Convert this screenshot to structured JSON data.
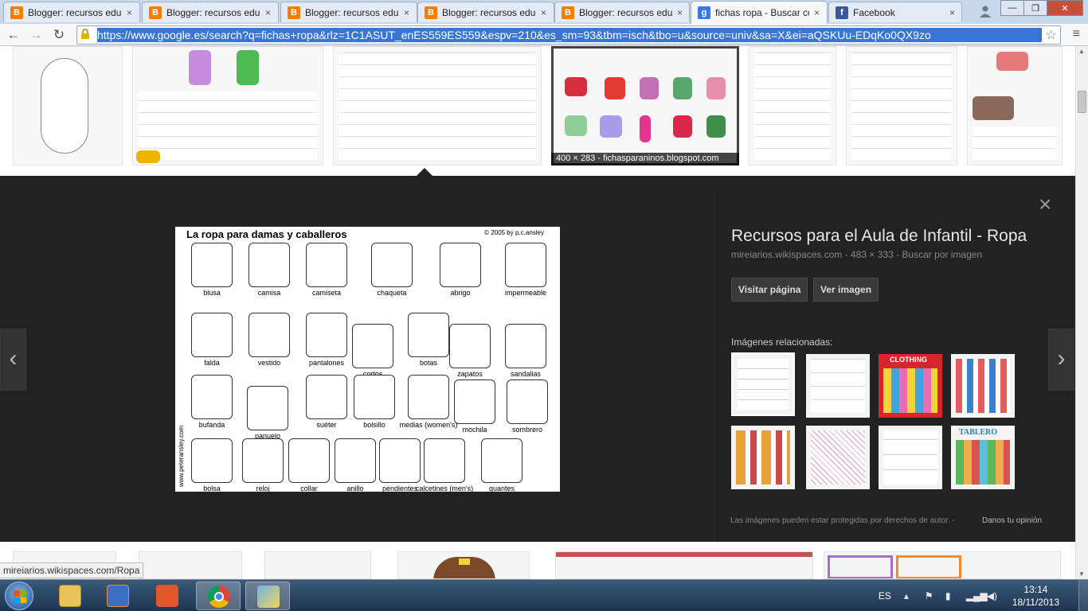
{
  "browser": {
    "tabs": [
      {
        "title": "Blogger: recursos edu",
        "icon": "blogger-icon",
        "color": "#f57d00"
      },
      {
        "title": "Blogger: recursos edu",
        "icon": "blogger-icon",
        "color": "#f57d00"
      },
      {
        "title": "Blogger: recursos edu",
        "icon": "blogger-icon",
        "color": "#f57d00"
      },
      {
        "title": "Blogger: recursos edu",
        "icon": "blogger-icon",
        "color": "#f57d00"
      },
      {
        "title": "Blogger: recursos edu",
        "icon": "blogger-icon",
        "color": "#f57d00"
      },
      {
        "title": "fichas ropa - Buscar co",
        "icon": "google-icon",
        "color": "#3b78e7"
      },
      {
        "title": "Facebook",
        "icon": "facebook-icon",
        "color": "#3b5998"
      }
    ],
    "tab_close_glyph": "×",
    "url": "https://www.google.es/search?q=fichas+ropa&rlz=1C1ASUT_enES559ES559&espv=210&es_sm=93&tbm=isch&tbo=u&source=univ&sa=X&ei=aQSKUu-EDqKo0QX9zo"
  },
  "results_strip": {
    "caption": "400 × 283 - fichasparaninos.blogspot.com"
  },
  "detail": {
    "preview": {
      "title": "La ropa para damas y caballeros",
      "copyright": "© 2005 by p.c.ansley",
      "side_credit": "www.peteransley.com",
      "items": [
        "blusa",
        "camisa",
        "camiseta",
        "chaqueta",
        "abrigo",
        "impermeable",
        "falda",
        "vestido",
        "pantalones",
        "cortos",
        "botas",
        "zapatos",
        "sandalias",
        "bufanda",
        "panuelo",
        "suéter",
        "bolsillo",
        "medias (women's)",
        "mochila",
        "sombrero",
        "bolsa",
        "reloj",
        "collar",
        "anillo",
        "pendientes",
        "calcetines (men's)",
        "guantes"
      ]
    },
    "title": "Recursos para el Aula de Infantil - Ropa",
    "meta": "mireiarios.wikispaces.com - 483 × 333 - Buscar por imagen",
    "visit_button": "Visitar página",
    "view_button": "Ver imagen",
    "related_label": "Imágenes relacionadas:",
    "related_tags": [
      "",
      "",
      "CLOTHING",
      "",
      "",
      "",
      "",
      "TABLERO"
    ],
    "copyright_notice": "Las imágenes pueden estar protegidas por derechos de autor.  -",
    "feedback_link": "Danos tu opinión",
    "prev_glyph": "‹",
    "next_glyph": "›",
    "close_glyph": "×"
  },
  "status_bar": "mireiarios.wikispaces.com/Ropa",
  "taskbar": {
    "language": "ES",
    "time": "13:14",
    "date": "18/11/2013"
  }
}
